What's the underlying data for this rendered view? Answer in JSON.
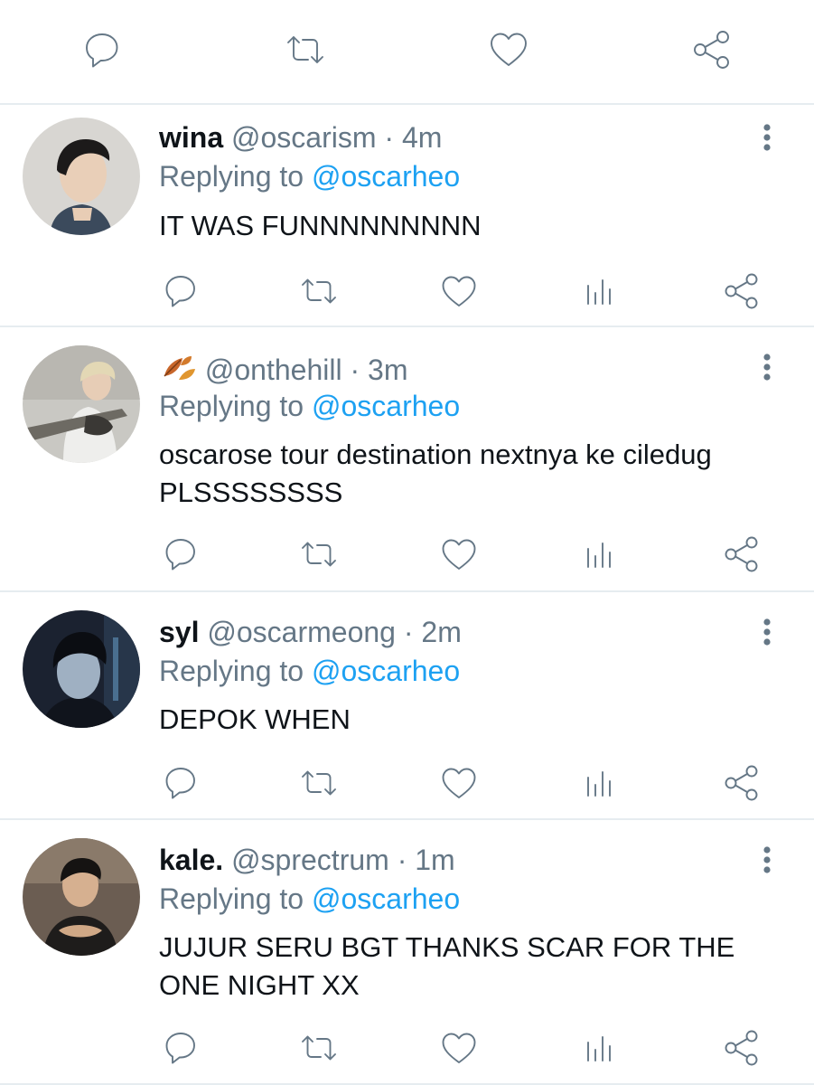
{
  "top_actions": [
    "reply-icon",
    "retweet-icon",
    "like-icon",
    "share-icon"
  ],
  "replies": [
    {
      "name": "wina",
      "handle": "@oscarism",
      "time": "4m",
      "replying_label": "Replying to",
      "replying_to": "@oscarheo",
      "text": "IT WAS FUNNNNNNNNN",
      "avatar_colors": [
        "#d8d6d2",
        "#3b4a5c"
      ]
    },
    {
      "name": "",
      "name_emoji": "autumn-leaves-icon",
      "handle": "@onthehill",
      "time": "3m",
      "replying_label": "Replying to",
      "replying_to": "@oscarheo",
      "text": "oscarose tour destination nextnya ke ciledug PLSSSSSSSS",
      "avatar_colors": [
        "#c9c8c3",
        "#6d6a63"
      ]
    },
    {
      "name": "syl",
      "handle": "@oscarmeong",
      "time": "2m",
      "replying_label": "Replying to",
      "replying_to": "@oscarheo",
      "text": "DEPOK WHEN",
      "avatar_colors": [
        "#1b2230",
        "#4a6f8f"
      ]
    },
    {
      "name": "kale.",
      "handle": "@sprectrum",
      "time": "1m",
      "replying_label": "Replying to",
      "replying_to": "@oscarheo",
      "text": "JUJUR SERU BGT THANKS SCAR FOR THE ONE NIGHT XX",
      "avatar_colors": [
        "#6b5d52",
        "#1e1c1b"
      ]
    }
  ],
  "action_icons": [
    "reply-icon",
    "retweet-icon",
    "like-icon",
    "analytics-icon",
    "share-icon"
  ],
  "colors": {
    "link": "#1da1f2",
    "secondary_text": "#657786",
    "primary_text": "#0f1419",
    "divider": "#e6ecf0"
  }
}
